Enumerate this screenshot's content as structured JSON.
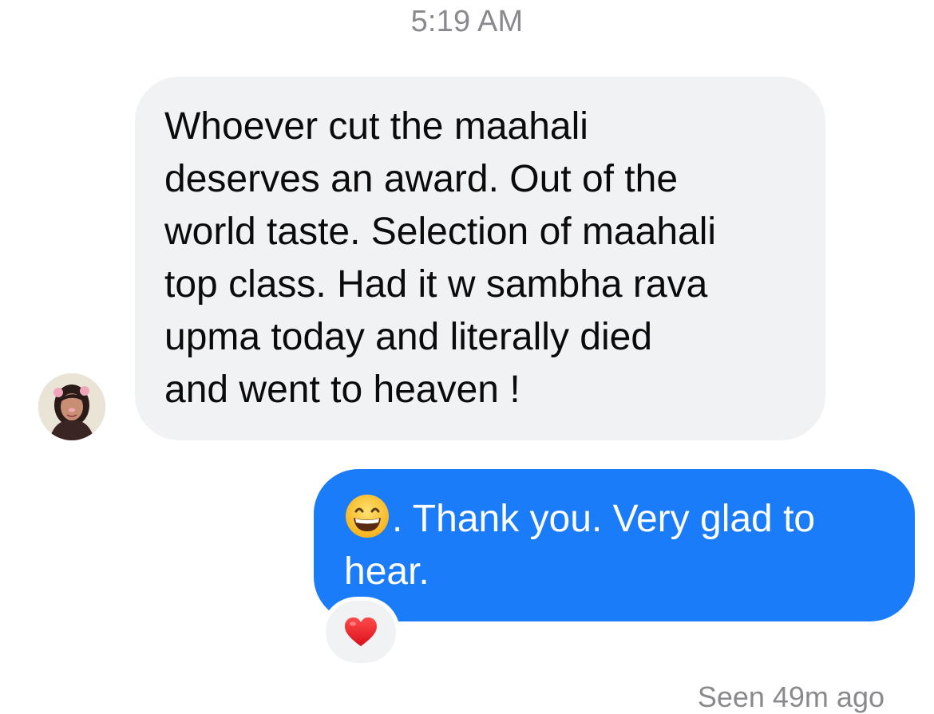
{
  "conversation": {
    "timestamp": "5:19 AM",
    "incoming": {
      "avatar_icon": "contact-avatar-photo",
      "text": "Whoever cut the maahali\ndeserves an award. Out of the\nworld taste. Selection of maahali\ntop class. Had it w sambha rava\nupma today and literally died\nand went to heaven !"
    },
    "outgoing": {
      "emoji_icon": "grinning-face-with-smiling-eyes-emoji",
      "text": ". Thank you. Very glad to\nhear.",
      "reaction_icon": "red-heart-icon"
    },
    "seen_status": "Seen 49m ago"
  },
  "colors": {
    "incoming_bubble": "#f1f2f4",
    "outgoing_bubble": "#1a7cf8",
    "meta_text": "#8a8a8e"
  }
}
